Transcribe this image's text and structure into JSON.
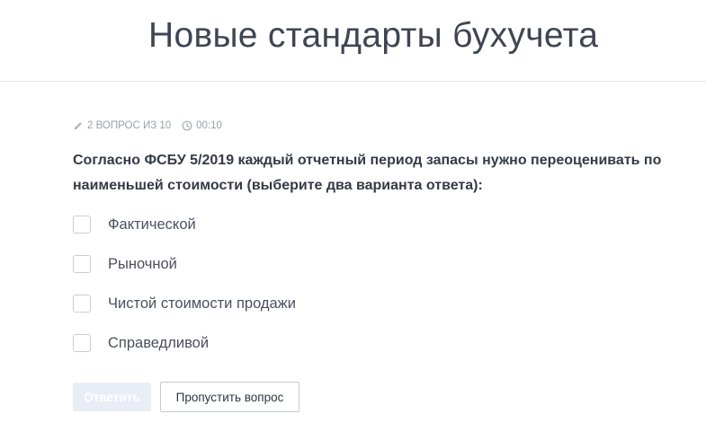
{
  "header": {
    "title": "Новые стандарты бухучета"
  },
  "quiz": {
    "progress_label": "2 ВОПРОС ИЗ 10",
    "timer": "00:10",
    "question": "Согласно ФСБУ 5/2019 каждый отчетный период запасы нужно переоценивать по наименьшей стоимости (выберите два варианта ответа):",
    "options": [
      {
        "label": "Фактической",
        "checked": false
      },
      {
        "label": "Рыночной",
        "checked": false
      },
      {
        "label": "Чистой стоимости продажи",
        "checked": false
      },
      {
        "label": "Справедливой",
        "checked": false
      }
    ]
  },
  "actions": {
    "answer_label": "Ответить",
    "answer_disabled": true,
    "skip_label": "Пропустить вопрос"
  },
  "icons": {
    "progress_icon": "pencil-icon",
    "timer_icon": "clock-icon"
  },
  "colors": {
    "text_primary": "#343a46",
    "text_muted": "#9aa0aa",
    "answer_button_bg": "#e9edf6",
    "divider": "#e4e6ea"
  }
}
